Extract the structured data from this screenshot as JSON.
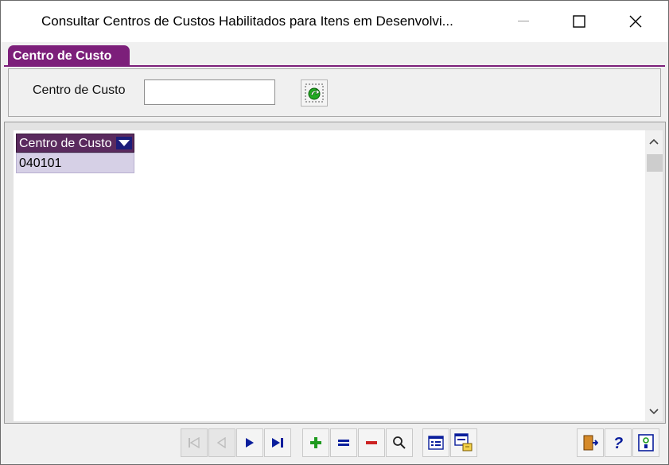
{
  "window": {
    "title": "Consultar Centros de Custos Habilitados para Itens em Desenvolvi...",
    "controls": [
      "minimize",
      "maximize",
      "close"
    ]
  },
  "tab": {
    "label": "Centro de Custo"
  },
  "filter": {
    "label": "Centro de Custo",
    "value": "",
    "refresh_icon": "refresh-arrow-icon"
  },
  "grid": {
    "columns": [
      {
        "header": "Centro de Custo"
      }
    ],
    "rows": [
      [
        "040101"
      ]
    ]
  },
  "toolbar": {
    "nav": [
      "first-record-icon",
      "previous-record-icon",
      "next-record-icon",
      "last-record-icon"
    ],
    "edit": [
      "add-icon",
      "equals-icon",
      "remove-icon",
      "search-icon"
    ],
    "view": [
      "form-view-icon",
      "export-icon"
    ],
    "right": [
      "exit-door-icon",
      "help-icon",
      "info-icon"
    ]
  },
  "colors": {
    "accent_purple": "#7c1f7a",
    "header_dark": "#5a2a5e",
    "selected_row": "#d6d0e6",
    "nav_blue": "#0a1e9c",
    "add_green": "#1e9a1e",
    "remove_red": "#cc2222"
  }
}
